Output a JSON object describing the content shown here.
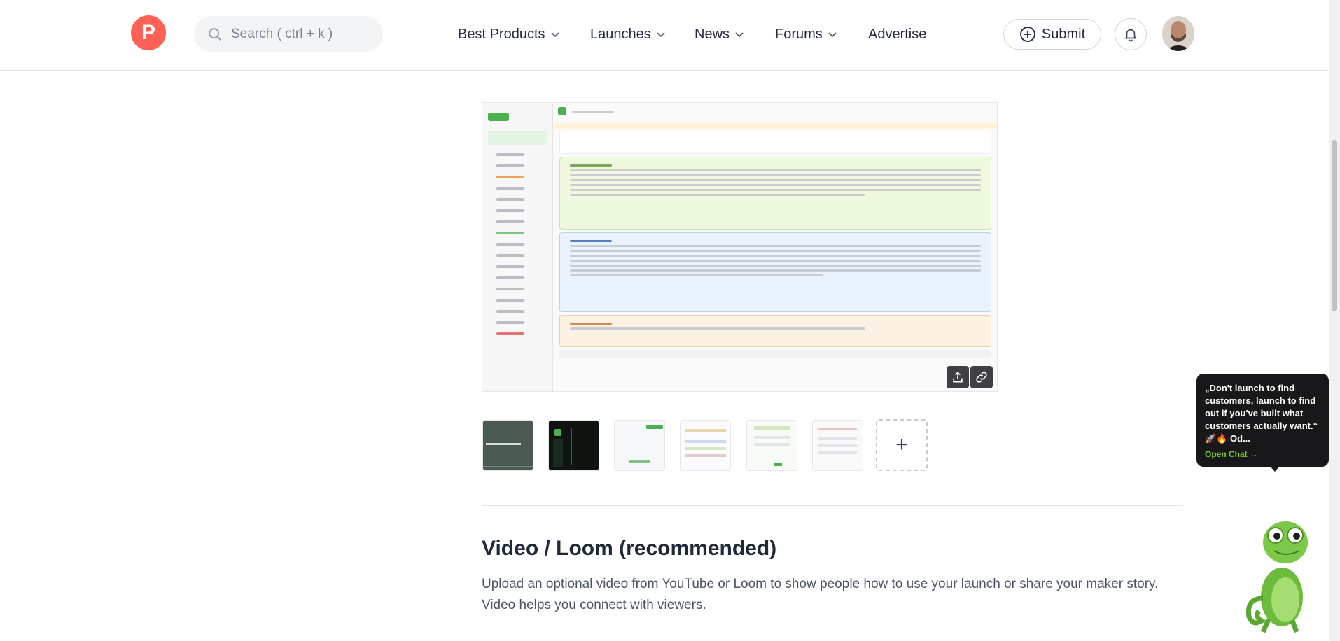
{
  "header": {
    "logo_letter": "P",
    "search_placeholder": "Search ( ctrl + k )",
    "nav": [
      {
        "label": "Best Products",
        "has_dropdown": true
      },
      {
        "label": "Launches",
        "has_dropdown": true
      },
      {
        "label": "News",
        "has_dropdown": true
      },
      {
        "label": "Forums",
        "has_dropdown": true
      },
      {
        "label": "Advertise",
        "has_dropdown": false
      }
    ],
    "submit_label": "Submit"
  },
  "gallery": {
    "thumbnail_count": 6,
    "add_label": "+"
  },
  "video_section": {
    "title": "Video / Loom (recommended)",
    "description": "Upload an optional video from YouTube or Loom to show people how to use your launch or share your maker story. Video helps you connect with viewers."
  },
  "chat_widget": {
    "quote": "„Don't launch to find customers, launch to find out if you've built what customers actually want.“",
    "emoji_line": "🚀🔥 Od...",
    "open_chat": "Open Chat →"
  },
  "colors": {
    "brand": "#ff6154",
    "text": "#21293c",
    "widget_bg": "#18181b",
    "widget_link": "#84cc16"
  }
}
